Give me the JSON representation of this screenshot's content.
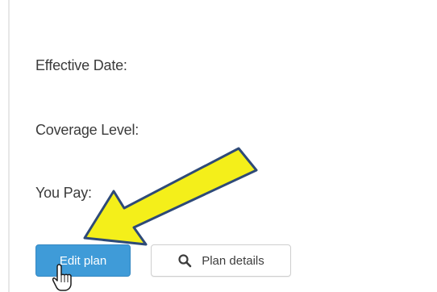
{
  "form": {
    "effective_date_label": "Effective Date:",
    "coverage_level_label": "Coverage Level:",
    "you_pay_label": "You Pay:"
  },
  "actions": {
    "edit_plan_label": "Edit plan",
    "plan_details_label": "Plan details",
    "plan_details_icon": "search-icon"
  },
  "annotation": {
    "arrow_icon": "arrow-icon",
    "arrow_color": "#f4ef1a",
    "arrow_outline_color": "#2e4a78"
  },
  "cursor": {
    "icon": "hand-pointer-icon"
  },
  "colors": {
    "primary_button": "#3f9bd8",
    "label_text": "#3b3b3b"
  }
}
